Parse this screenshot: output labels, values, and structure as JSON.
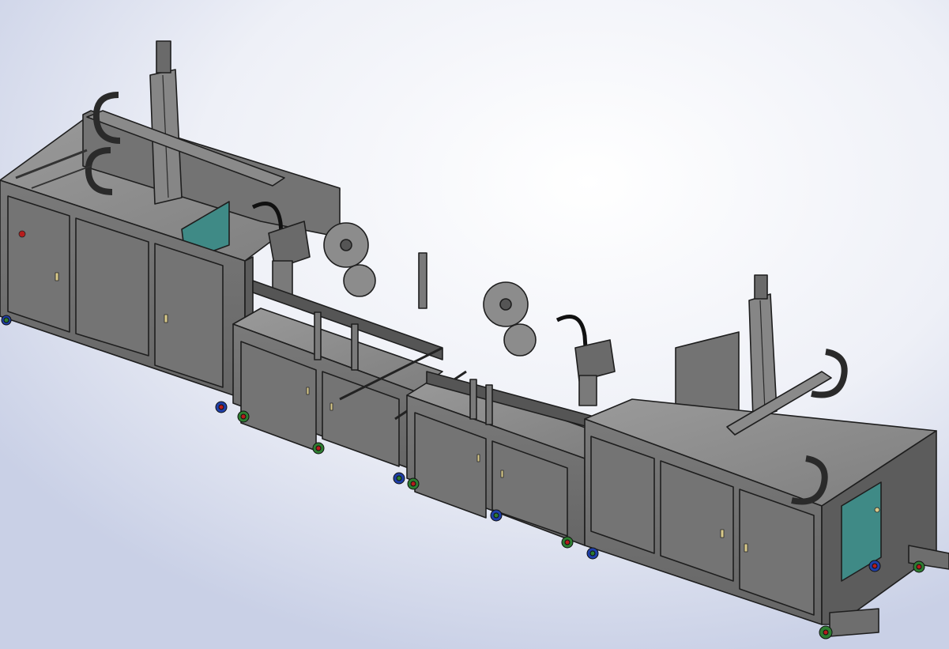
{
  "scene": {
    "description_visible_text": "",
    "colors": {
      "background_top": "#cfd6ea",
      "background_bottom": "#ffffff",
      "cabinet_face": "#6e6e6e",
      "cabinet_edge": "#2a2a2a",
      "panel_teal": "#3f8a86",
      "caster_green": "#2e7d32",
      "caster_red": "#b71c1c",
      "caster_blue": "#1f3fa8"
    },
    "icons": [
      "machine-assembly-line",
      "gantry-robot",
      "tape-reel",
      "cable-chain",
      "caster-wheel"
    ]
  }
}
